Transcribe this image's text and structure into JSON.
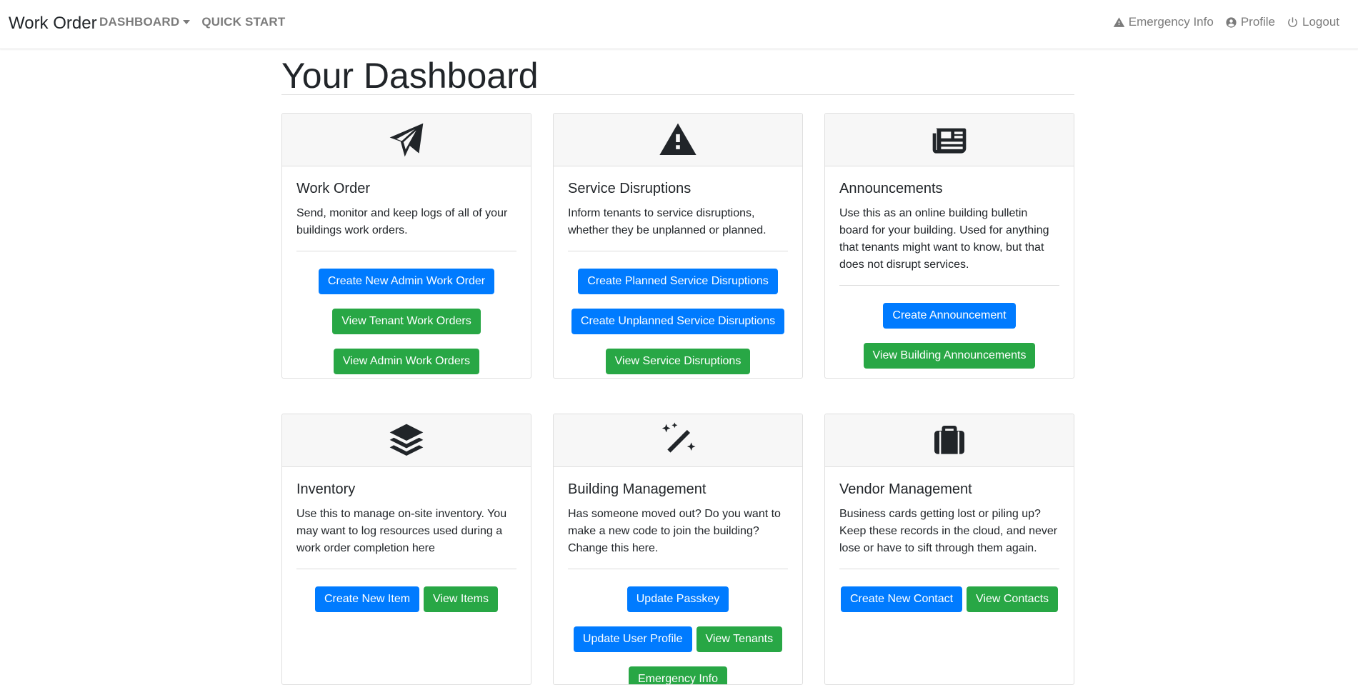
{
  "navbar": {
    "brand": "Work Order",
    "dashboard": "DASHBOARD",
    "quick_start": "QUICK START",
    "emergency": "Emergency Info",
    "profile": "Profile",
    "logout": "Logout"
  },
  "page": {
    "title": "Your Dashboard"
  },
  "cards": {
    "work_order": {
      "icon": "paper-plane-icon",
      "title": "Work Order",
      "text": "Send, monitor and keep logs of all of your buildings work orders.",
      "btn1": "Create New Admin Work Order",
      "btn2": "View Tenant Work Orders",
      "btn3": "View Admin Work Orders"
    },
    "service": {
      "icon": "warning-icon",
      "title": "Service Disruptions",
      "text": "Inform tenants to service disruptions, whether they be unplanned or planned.",
      "btn1": "Create Planned Service Disruptions",
      "btn2": "Create Unplanned Service Disruptions",
      "btn3": "View Service Disruptions"
    },
    "announcements": {
      "icon": "newspaper-icon",
      "title": "Announcements",
      "text": "Use this as an online building bulletin board for your building. Used for anything that tenants might want to know, but that does not disrupt services.",
      "btn1": "Create Announcement",
      "btn2": "View Building Announcements"
    },
    "inventory": {
      "icon": "layers-icon",
      "title": "Inventory",
      "text": "Use this to manage on-site inventory. You may want to log resources used during a work order completion here",
      "btn1": "Create New Item",
      "btn2": "View Items"
    },
    "building": {
      "icon": "magic-wand-icon",
      "title": "Building Management",
      "text": "Has someone moved out? Do you want to make a new code to join the building? Change this here.",
      "btn1": "Update Passkey",
      "btn2": "Update User Profile",
      "btn3": "View Tenants",
      "btn4": "Emergency Info"
    },
    "vendor": {
      "icon": "briefcase-icon",
      "title": "Vendor Management",
      "text": "Business cards getting lost or piling up? Keep these records in the cloud, and never lose or have to sift through them again.",
      "btn1": "Create New Contact",
      "btn2": "View Contacts"
    }
  },
  "colors": {
    "primary": "#007bff",
    "success": "#28a745",
    "text": "#212529",
    "nav_text": "#7b7b7b"
  }
}
